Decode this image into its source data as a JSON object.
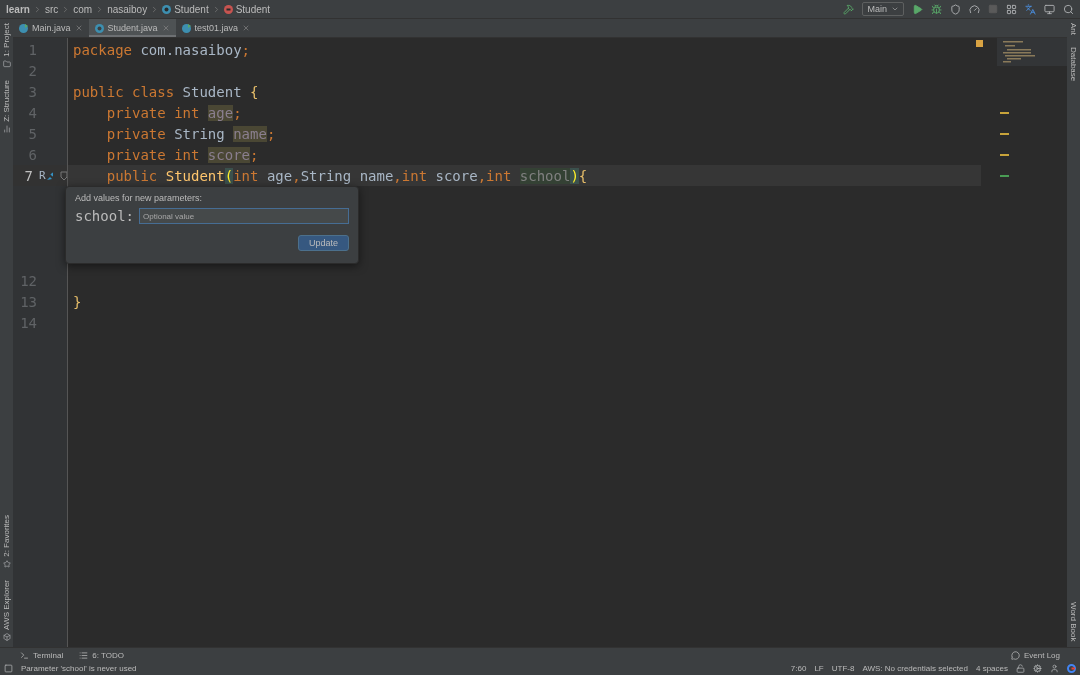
{
  "breadcrumbs": [
    {
      "label": "learn",
      "kind": "project"
    },
    {
      "label": "src",
      "kind": "folder"
    },
    {
      "label": "com",
      "kind": "folder"
    },
    {
      "label": "nasaiboy",
      "kind": "folder"
    },
    {
      "label": "Student",
      "kind": "class"
    },
    {
      "label": "Student",
      "kind": "method"
    }
  ],
  "toolbar": {
    "run_config": "Main",
    "stop_disabled": true
  },
  "tabs": [
    {
      "label": "Main.java",
      "selected": false,
      "kind": "runnable"
    },
    {
      "label": "Student.java",
      "selected": true,
      "kind": "class"
    },
    {
      "label": "test01.java",
      "selected": false,
      "kind": "runnable"
    }
  ],
  "left_tools_top": [
    {
      "label": "1: Project",
      "kind": "folder"
    },
    {
      "label": "Z: Structure",
      "kind": "structure"
    }
  ],
  "left_tools_bottom": [
    {
      "label": "2: Favorites",
      "kind": "star"
    },
    {
      "label": "AWS Explorer",
      "kind": "cube"
    }
  ],
  "right_tools_top": [
    "Ant",
    "Database"
  ],
  "right_tools_bottom": [
    "Word Book"
  ],
  "lines_above": [
    {
      "number": "1",
      "current": false,
      "tokens": [
        {
          "text": "package ",
          "kind": "keyword"
        },
        {
          "text": "com.nasaiboy",
          "kind": "plain"
        },
        {
          "text": ";",
          "kind": "keyword"
        }
      ]
    },
    {
      "number": "2",
      "current": false
    },
    {
      "number": "3",
      "current": false,
      "tokens": [
        {
          "text": "public class ",
          "kind": "keyword"
        },
        {
          "text": "Student ",
          "kind": "plain"
        },
        {
          "text": "{",
          "kind": "brace"
        }
      ]
    },
    {
      "number": "4",
      "current": false,
      "color": "#c8a33a",
      "tokens": [
        {
          "text": "    private int ",
          "kind": "keyword"
        },
        {
          "text": "age",
          "kind": "unused_field"
        },
        {
          "text": ";",
          "kind": "keyword"
        }
      ]
    },
    {
      "number": "5",
      "current": false,
      "color": "#c8a33a",
      "tokens": [
        {
          "text": "    private ",
          "kind": "keyword"
        },
        {
          "text": "String ",
          "kind": "plain"
        },
        {
          "text": "name",
          "kind": "unused_field"
        },
        {
          "text": ";",
          "kind": "keyword"
        }
      ]
    },
    {
      "number": "6",
      "current": false,
      "color": "#c8a33a",
      "tokens": [
        {
          "text": "    private int ",
          "kind": "keyword"
        },
        {
          "text": "score",
          "kind": "unused_field"
        },
        {
          "text": ";",
          "kind": "keyword"
        }
      ]
    },
    {
      "number": "7",
      "current": true,
      "color": "#499c54",
      "gutter": "R",
      "tokens": [
        {
          "text": "    public ",
          "kind": "keyword"
        },
        {
          "text": "Student",
          "kind": "method"
        },
        {
          "text": "(",
          "kind": "brace_match"
        },
        {
          "text": "int ",
          "kind": "keyword"
        },
        {
          "text": "age",
          "kind": "plain"
        },
        {
          "text": ",",
          "kind": "keyword"
        },
        {
          "text": "String ",
          "kind": "plain"
        },
        {
          "text": "name",
          "kind": "plain"
        },
        {
          "text": ",",
          "kind": "keyword"
        },
        {
          "text": "int ",
          "kind": "keyword"
        },
        {
          "text": "score",
          "kind": "plain"
        },
        {
          "text": ",",
          "kind": "keyword"
        },
        {
          "text": "int ",
          "kind": "keyword"
        },
        {
          "text": "school",
          "kind": "unused_param"
        },
        {
          "text": ")",
          "kind": "brace_match"
        },
        {
          "text": "{",
          "kind": "brace"
        }
      ]
    }
  ],
  "lines_below": [
    {
      "number": "12",
      "current": false
    },
    {
      "number": "13",
      "current": false,
      "tokens": [
        {
          "text": "}",
          "kind": "brace"
        }
      ]
    },
    {
      "number": "14",
      "current": false
    }
  ],
  "popup": {
    "title": "Add values for new parameters:",
    "label": "school:",
    "placeholder": "Optional value",
    "button": "Update"
  },
  "bottom_tools": [
    {
      "label": "Terminal",
      "kind": "terminal"
    },
    {
      "label": "6: TODO",
      "kind": "list"
    }
  ],
  "event_log": "Event Log",
  "status": {
    "message": "Parameter 'school' is never used",
    "items": [
      "7:60",
      "LF",
      "UTF-8",
      "AWS: No credentials selected",
      "4 spaces"
    ]
  }
}
